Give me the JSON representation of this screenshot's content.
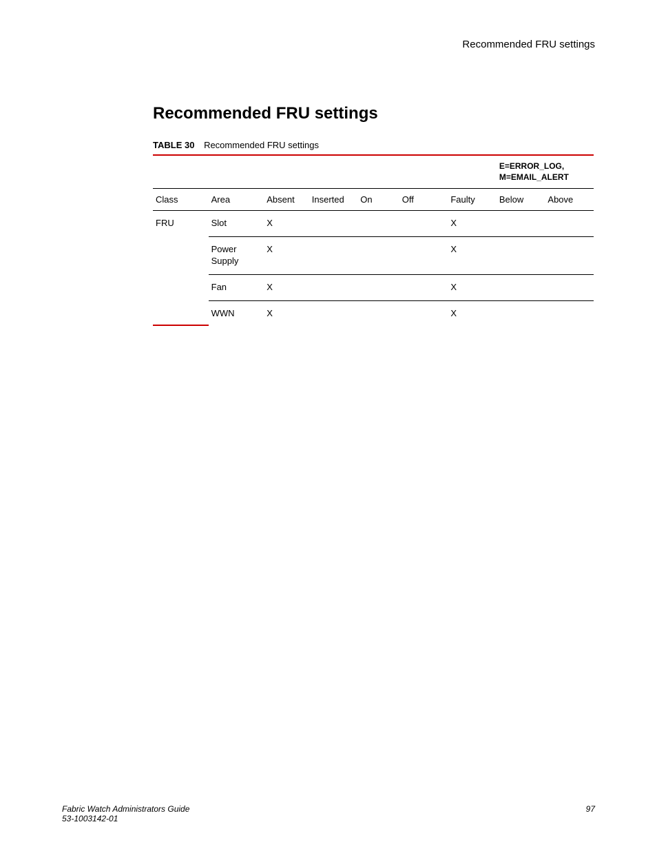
{
  "runningHead": "Recommended FRU settings",
  "sectionTitle": "Recommended FRU settings",
  "table": {
    "label": "TABLE 30",
    "caption": "Recommended FRU settings",
    "legendLine1": "E=ERROR_LOG,",
    "legendLine2": "M=EMAIL_ALERT",
    "headers": {
      "class": "Class",
      "area": "Area",
      "absent": "Absent",
      "inserted": "Inserted",
      "on": "On",
      "off": "Off",
      "faulty": "Faulty",
      "below": "Below",
      "above": "Above"
    },
    "classLabel": "FRU",
    "rows": [
      {
        "area": "Slot",
        "absent": "X",
        "inserted": "",
        "on": "",
        "off": "",
        "faulty": "X",
        "below": "",
        "above": ""
      },
      {
        "area": "Power Supply",
        "absent": "X",
        "inserted": "",
        "on": "",
        "off": "",
        "faulty": "X",
        "below": "",
        "above": ""
      },
      {
        "area": "Fan",
        "absent": "X",
        "inserted": "",
        "on": "",
        "off": "",
        "faulty": "X",
        "below": "",
        "above": ""
      },
      {
        "area": "WWN",
        "absent": "X",
        "inserted": "",
        "on": "",
        "off": "",
        "faulty": "X",
        "below": "",
        "above": ""
      }
    ]
  },
  "footer": {
    "title": "Fabric Watch Administrators Guide",
    "docNumber": "53-1003142-01",
    "pageNumber": "97"
  },
  "chart_data": {
    "type": "table",
    "title": "Recommended FRU settings",
    "columns": [
      "Class",
      "Area",
      "Absent",
      "Inserted",
      "On",
      "Off",
      "Faulty",
      "Below",
      "Above"
    ],
    "legend": "E=ERROR_LOG, M=EMAIL_ALERT",
    "rows": [
      [
        "FRU",
        "Slot",
        "X",
        "",
        "",
        "",
        "X",
        "",
        ""
      ],
      [
        "FRU",
        "Power Supply",
        "X",
        "",
        "",
        "",
        "X",
        "",
        ""
      ],
      [
        "FRU",
        "Fan",
        "X",
        "",
        "",
        "",
        "X",
        "",
        ""
      ],
      [
        "FRU",
        "WWN",
        "X",
        "",
        "",
        "",
        "X",
        "",
        ""
      ]
    ]
  }
}
